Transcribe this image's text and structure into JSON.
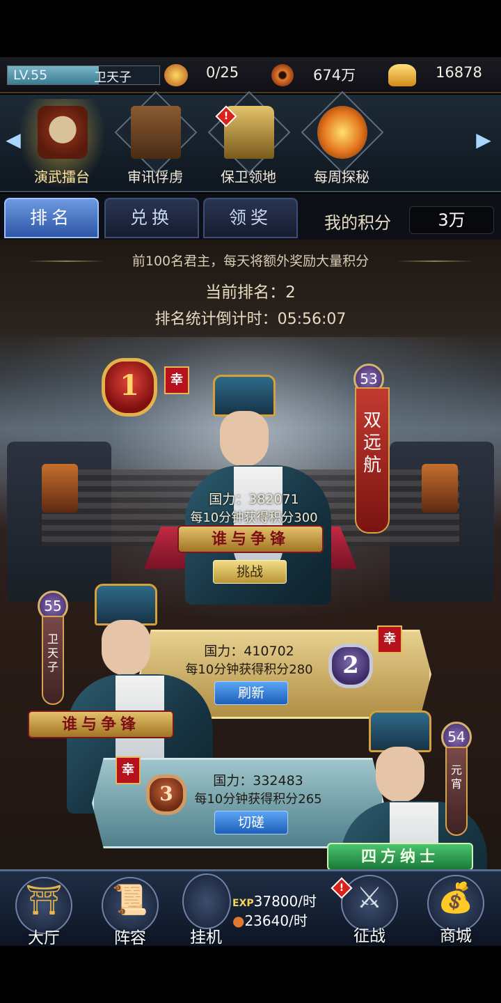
{
  "status": {
    "level": "LV.55",
    "exp_fraction": 0.6,
    "player_name": "卫天子",
    "stamina": "0/25",
    "copper": "674万",
    "gold": "16878"
  },
  "activities": [
    {
      "label": "演武擂台",
      "selected": true,
      "icon": "drum-icon",
      "alert": false
    },
    {
      "label": "审讯俘虏",
      "selected": false,
      "icon": "shackles-icon",
      "alert": false
    },
    {
      "label": "保卫领地",
      "selected": false,
      "icon": "tower-icon",
      "alert": true
    },
    {
      "label": "每周探秘",
      "selected": false,
      "icon": "treasure-icon",
      "alert": false
    }
  ],
  "tabs": [
    {
      "label": "排名",
      "active": true
    },
    {
      "label": "兑换",
      "active": false
    },
    {
      "label": "领奖",
      "active": false
    }
  ],
  "score": {
    "label": "我的积分",
    "value": "3万"
  },
  "notice": "前100名君主，每天将额外奖励大量积分",
  "current_rank_label": "当前排名：",
  "current_rank": "2",
  "countdown_label": "排名统计倒计时：",
  "countdown": "05:56:07",
  "luck_label": "幸",
  "alert_mark": "!",
  "ranks": [
    {
      "rank": "1",
      "name": "双远航",
      "level": "53",
      "power_label": "国力：",
      "power": "382071",
      "gain": "每10分钟获得积分300",
      "title": "谁与争锋",
      "button": "挑战"
    },
    {
      "rank": "2",
      "name": "卫天子",
      "level": "55",
      "power_label": "国力：",
      "power": "410702",
      "gain": "每10分钟获得积分280",
      "title": "谁与争锋",
      "button": "刷新"
    },
    {
      "rank": "3",
      "name": "元宵",
      "level": "54",
      "power_label": "国力：",
      "power": "332483",
      "gain": "每10分钟获得积分265",
      "title": "四方纳士",
      "button": "切磋"
    }
  ],
  "nav": {
    "hall": "大厅",
    "lineup": "阵容",
    "idle": "挂机",
    "idle_exp_tag": "EXP",
    "idle_exp": "37800/时",
    "idle_copper": "23640/时",
    "battle": "征战",
    "shop": "商城"
  },
  "colors": {
    "accent_blue": "#2e55a6",
    "gold": "#e2b24b",
    "banner_red": "#c23a30"
  }
}
